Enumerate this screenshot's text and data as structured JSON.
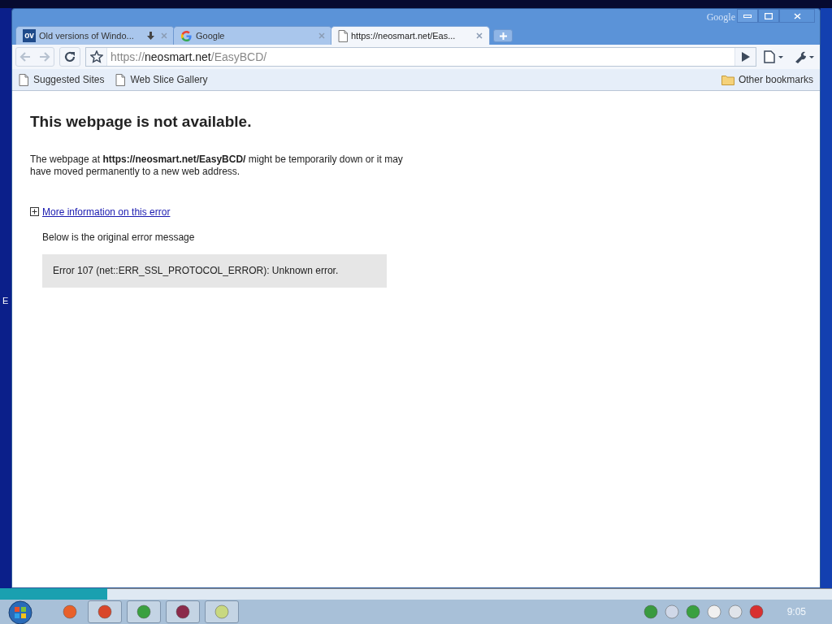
{
  "desktop": {
    "edge_text": "E"
  },
  "window": {
    "brand": "Google"
  },
  "tabs": [
    {
      "title": "Old versions of Windo...",
      "selected": false,
      "kind": "ov",
      "icon_text": "ov",
      "downloading": true
    },
    {
      "title": "Google",
      "selected": false,
      "kind": "google",
      "downloading": false
    },
    {
      "title": "https://neosmart.net/Eas...",
      "selected": true,
      "kind": "page",
      "downloading": false
    }
  ],
  "address_bar": {
    "parts": [
      {
        "text": "https://",
        "kind": "dim"
      },
      {
        "text": "neosmart.net",
        "kind": "host"
      },
      {
        "text": "/EasyBCD/",
        "kind": "dim"
      }
    ]
  },
  "bookmarks": [
    {
      "label": "Suggested Sites",
      "kind": "page"
    },
    {
      "label": "Web Slice Gallery",
      "kind": "page"
    }
  ],
  "other_bookmarks": "Other bookmarks",
  "page": {
    "heading": "This webpage is not available.",
    "message": "The webpage at **https://neosmart.net/EasyBCD/** might be temporarily down or it may have moved permanently to a new web address.",
    "more_info_link": "More information on this error",
    "details_intro": "Below is the original error message",
    "error": "Error 107 (net::ERR_SSL_PROTOCOL_ERROR): Unknown error."
  },
  "taskbar": {
    "clock": "9:05"
  }
}
